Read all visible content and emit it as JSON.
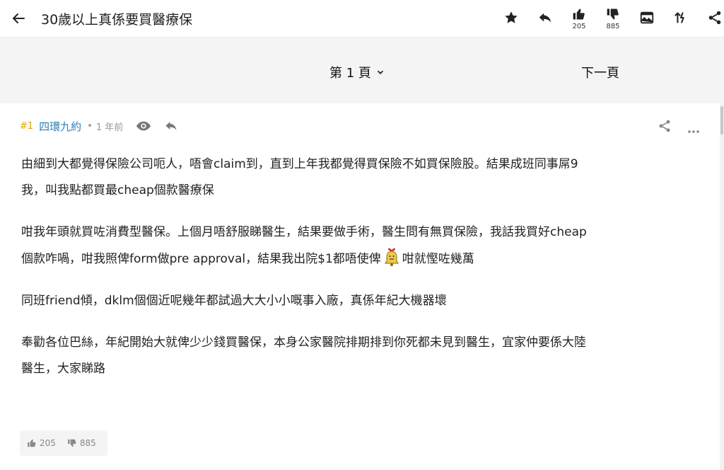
{
  "header": {
    "title": "30歲以上真係要買醫療保",
    "likes": "205",
    "dislikes": "885",
    "icons": [
      "back-arrow-icon",
      "star-icon",
      "reply-icon",
      "thumbs-up-icon",
      "thumbs-down-icon",
      "image-icon",
      "sort-icon",
      "share-icon"
    ]
  },
  "pagination": {
    "current": "第 1 頁",
    "next": "下一頁"
  },
  "post": {
    "number": "#1",
    "username": "四環九約",
    "separator": "•",
    "time": "1 年前",
    "paragraphs": [
      [
        "由細到大都覺得保險公司呃人，唔會claim到，直到上年我都覺得買保險不如買保險股。結果成班同事屌9",
        "我，叫我點都買最cheap個款醫療保"
      ],
      [
        "咁我年頭就買咗消費型醫保。上個月唔舒服睇醫生，結果要做手術，醫生問有無買保險，我話我買好cheap",
        "個款咋喎，咁我照俾form做pre approval，結果我出院$1都唔使俾",
        "咁就慳咗幾萬"
      ],
      [
        "同班friend傾，dklm個個近呢幾年都試過大大小小嘅事入廠，真係年紀大機器壞"
      ],
      [
        "奉勸各位巴絲，年紀開始大就俾少少錢買醫保，本身公家醫院排期排到你死都未見到醫生，宜家仲要係大陸",
        "醫生，大家睇路"
      ]
    ],
    "likes": "205",
    "dislikes": "885"
  },
  "colors": {
    "accent_number": "#e0a800",
    "username": "#2f7fb8",
    "page_bar_bg": "#f4f4f4"
  }
}
